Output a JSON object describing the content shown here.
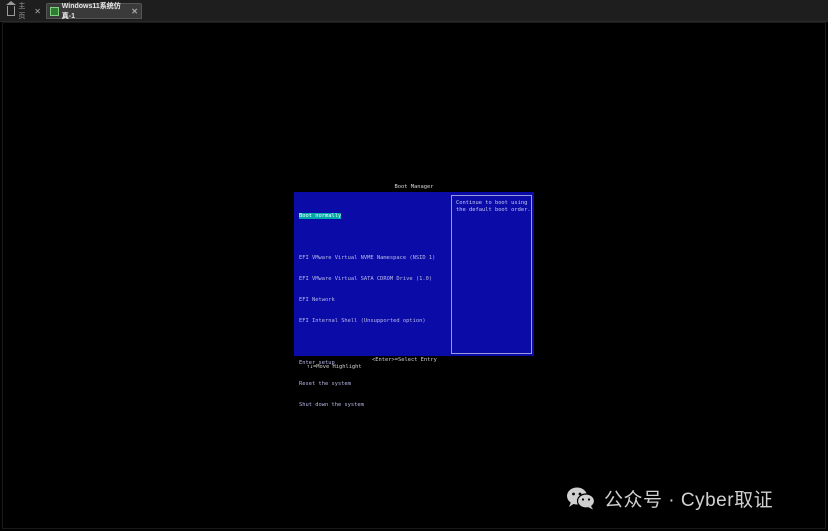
{
  "tabs": [
    {
      "label": "主页",
      "close": "✕"
    },
    {
      "label": "Windows11系统仿真-1",
      "close": "✕"
    }
  ],
  "boot_manager": {
    "title": "Boot Manager",
    "items": [
      "Boot normally",
      "EFI VMware Virtual NVME Namespace (NSID 1)",
      "EFI VMware Virtual SATA CDROM Drive (1.0)",
      "EFI Network",
      "EFI Internal Shell (Unsupported option)",
      "Enter setup",
      "Reset the system",
      "Shut down the system"
    ],
    "selected_index": 0,
    "help_text": "Continue to boot using\nthe default boot order.",
    "footer": {
      "move_hint": "↑↓=Move Highlight",
      "select_hint": "<Enter>=Select Entry"
    },
    "colors": {
      "panel": "#0b0ba8",
      "highlight": "#00a8a8"
    }
  },
  "watermark": {
    "text": "公众号 · Cyber取证",
    "logo_icon": "wechat-icon"
  }
}
